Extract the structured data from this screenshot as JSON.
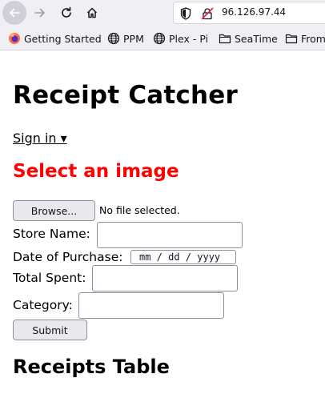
{
  "browser": {
    "url": "96.126.97.44",
    "colors": {
      "chrome_bg": "#f0f0f4",
      "active_button": "#cfcfd8",
      "insecure_lock": "#e22850"
    },
    "bookmarks": [
      {
        "label": "Getting Started",
        "icon": "firefox-icon"
      },
      {
        "label": "PPM",
        "icon": "globe-icon"
      },
      {
        "label": "Plex - Pi",
        "icon": "globe-icon"
      },
      {
        "label": "SeaTime",
        "icon": "folder-icon"
      },
      {
        "label": "From",
        "icon": "folder-icon"
      }
    ]
  },
  "page": {
    "title": "Receipt Catcher",
    "signin_label": "Sign in ▾",
    "select_heading": "Select an image",
    "select_heading_color": "#ff0000",
    "file": {
      "browse_label": "Browse...",
      "status": "No file selected."
    },
    "form": {
      "store_label": "Store Name:",
      "store_value": "",
      "date_label": "Date of Purchase:",
      "date_placeholder": "mm / dd / yyyy",
      "total_label": "Total Spent:",
      "total_value": "",
      "category_label": "Category:",
      "category_value": "",
      "submit_label": "Submit"
    },
    "table_heading": "Receipts Table"
  }
}
